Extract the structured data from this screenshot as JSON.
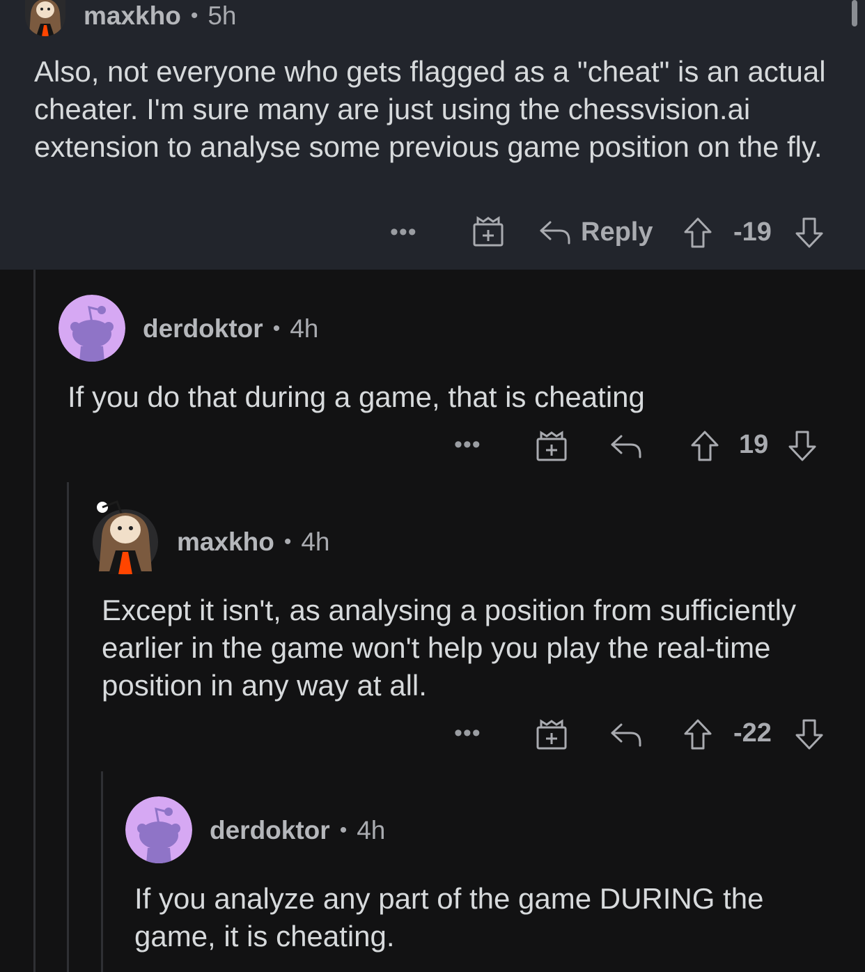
{
  "comments": [
    {
      "username": "maxkho",
      "separator": "•",
      "age": "5h",
      "body": "Also, not everyone who gets flagged as a \"cheat\" is an actual cheater. I'm sure many are just using the chessvision.ai extension to analyse some previous game position on the fly.",
      "more_label": "•••",
      "reply_label": "Reply",
      "score": "-19",
      "highlighted": true
    },
    {
      "username": "derdoktor",
      "separator": "•",
      "age": "4h",
      "body": "If you do that during a game, that is cheating",
      "more_label": "•••",
      "score": "19"
    },
    {
      "username": "maxkho",
      "separator": "•",
      "age": "4h",
      "body": "Except it isn't, as analysing a position from sufficiently earlier in the game won't help you play the real-time position in any way at all.",
      "more_label": "•••",
      "score": "-22"
    },
    {
      "username": "derdoktor",
      "separator": "•",
      "age": "4h",
      "body": "If you analyze any part of the game DURING the game, it is cheating."
    }
  ],
  "colors": {
    "background": "#121213",
    "highlight": "#22252c",
    "avatar_purple": "#d6a8f3",
    "snoo_body": "#8f74c7"
  },
  "icons": {
    "more": "more-icon",
    "award": "gift-award-icon",
    "reply": "reply-arrow-icon",
    "upvote": "upvote-arrow-icon",
    "downvote": "downvote-arrow-icon"
  }
}
